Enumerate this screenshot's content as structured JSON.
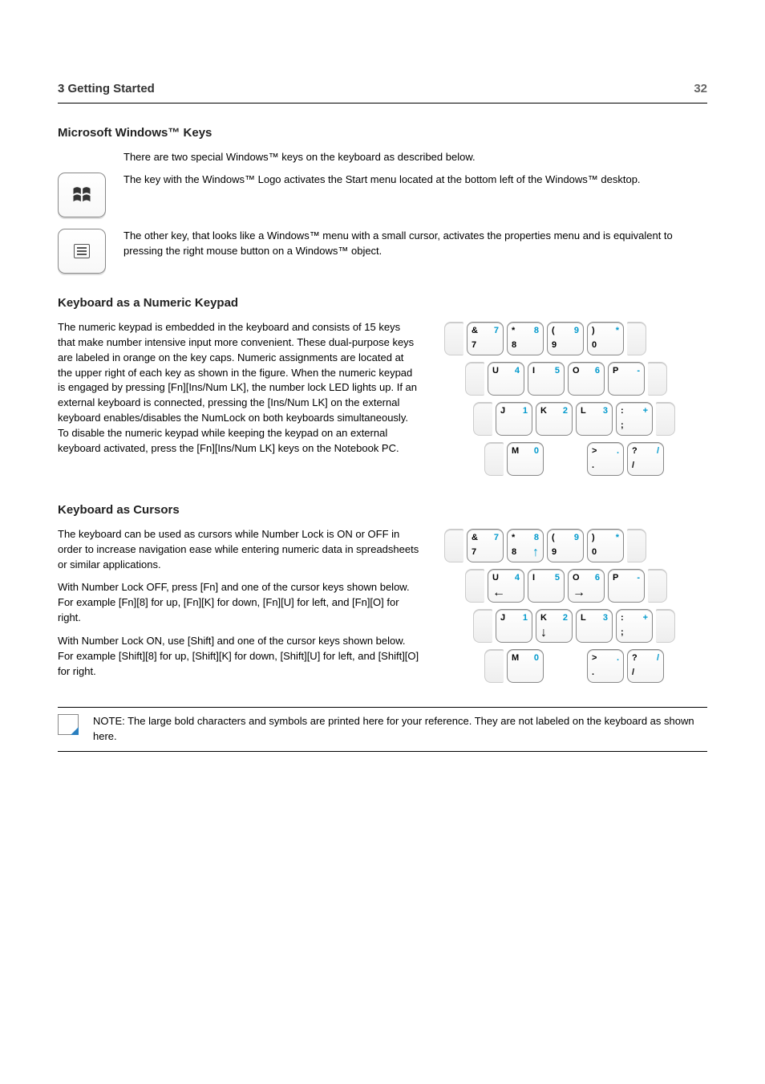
{
  "header": {
    "section": "3    Getting Started",
    "page": "32"
  },
  "sections": {
    "msWinKeys": {
      "title": "Microsoft Windows™ Keys",
      "intro": "There are two special Windows™ keys on the keyboard as described below.",
      "winKey": "The key with the Windows™ Logo activates the Start menu located at the bottom left of the Windows™ desktop.",
      "ctxKey": "The other key, that looks like a Windows™ menu with a small cursor, activates the properties menu and is equivalent to pressing the right mouse button on a Windows™ object."
    },
    "numpad": {
      "title": "Keyboard as a Numeric Keypad",
      "text": "The numeric keypad is embedded in the keyboard and consists of 15 keys that make number intensive input more convenient. These dual-purpose keys are labeled in orange on the key caps. Numeric assignments are located at the upper right of each key as shown in the figure. When the numeric keypad is engaged by pressing [Fn][Ins/Num LK], the number lock LED lights up. If an external keyboard is connected, pressing the [Ins/Num LK] on the external keyboard enables/disables the NumLock on both keyboards simultaneously. To disable the numeric keypad while keeping the keypad on an external keyboard activated, press the [Fn][Ins/Num LK] keys on the Notebook PC."
    },
    "cursors": {
      "title": "Keyboard as Cursors",
      "text": "The keyboard can be used as cursors while Number Lock is ON or OFF in order to increase navigation ease while entering numeric data in spreadsheets or similar applications.",
      "withOff": "With Number Lock OFF, press [Fn] and one of the cursor keys shown below. For example [Fn][8] for up, [Fn][K] for down, [Fn][U] for left, and [Fn][O] for right.",
      "withOn": "With Number Lock ON, use [Shift] and one of the cursor keys shown below. For example [Shift][8] for up, [Shift][K] for down, [Shift][U] for left, and [Shift][O] for right."
    }
  },
  "note": "NOTE: The large bold characters and symbols are printed here for your reference. They are not labeled on the keyboard as shown here.",
  "keypadA": {
    "row1": [
      {
        "tl": "&",
        "tr": "7",
        "bl": "7"
      },
      {
        "tl": "*",
        "tr": "8",
        "bl": "8"
      },
      {
        "tl": "(",
        "tr": "9",
        "bl": "9"
      },
      {
        "tl": ")",
        "tr": "*",
        "bl": "0"
      }
    ],
    "row2": [
      {
        "tl": "U",
        "tr": "4"
      },
      {
        "tl": "I",
        "tr": "5"
      },
      {
        "tl": "O",
        "tr": "6"
      },
      {
        "tl": "P",
        "tr": "-"
      }
    ],
    "row3": [
      {
        "tl": "J",
        "tr": "1"
      },
      {
        "tl": "K",
        "tr": "2"
      },
      {
        "tl": "L",
        "tr": "3"
      },
      {
        "tl": ":",
        "tr": "+",
        "bl": ";"
      }
    ],
    "row4": [
      {
        "tl": "M",
        "tr": "0"
      },
      null,
      {
        "tl": ">",
        "tr": ".",
        "bl": "."
      },
      {
        "tl": "?",
        "tr": "/",
        "bl": "/"
      }
    ]
  },
  "keypadB": {
    "row1": [
      {
        "tl": "&",
        "tr": "7",
        "bl": "7"
      },
      {
        "tl": "*",
        "tr": "8",
        "bl": "8",
        "arrow": "↑"
      },
      {
        "tl": "(",
        "tr": "9",
        "bl": "9"
      },
      {
        "tl": ")",
        "tr": "*",
        "bl": "0"
      }
    ],
    "row2": [
      {
        "tl": "U",
        "tr": "4",
        "arrow": "←"
      },
      {
        "tl": "I",
        "tr": "5"
      },
      {
        "tl": "O",
        "tr": "6",
        "arrow": "→"
      },
      {
        "tl": "P",
        "tr": "-"
      }
    ],
    "row3": [
      {
        "tl": "J",
        "tr": "1"
      },
      {
        "tl": "K",
        "tr": "2",
        "arrow": "↓"
      },
      {
        "tl": "L",
        "tr": "3"
      },
      {
        "tl": ":",
        "tr": "+",
        "bl": ";"
      }
    ],
    "row4": [
      {
        "tl": "M",
        "tr": "0"
      },
      null,
      {
        "tl": ">",
        "tr": ".",
        "bl": "."
      },
      {
        "tl": "?",
        "tr": "/",
        "bl": "/"
      }
    ]
  }
}
